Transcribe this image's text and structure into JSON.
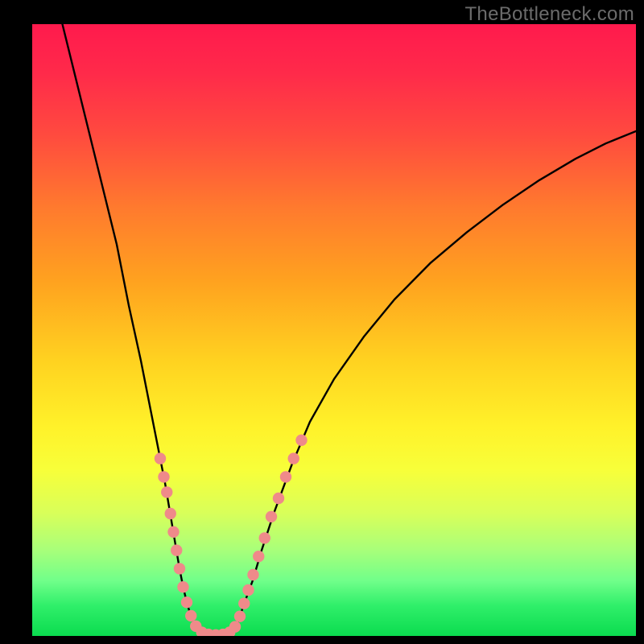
{
  "attribution": "TheBottleneck.com",
  "chart_data": {
    "type": "line",
    "title": "",
    "xlabel": "",
    "ylabel": "",
    "xlim": [
      0,
      100
    ],
    "ylim": [
      0,
      100
    ],
    "grid": false,
    "legend": false,
    "series": [
      {
        "name": "left-curve",
        "x": [
          5,
          8,
          11,
          14,
          16,
          18,
          19,
          20,
          21,
          22,
          22.6,
          23.2,
          23.8,
          24.4,
          25,
          25.6,
          26.2,
          26.8,
          27.4,
          28
        ],
        "y": [
          100,
          88,
          76,
          64,
          54,
          45,
          40,
          35,
          30,
          25,
          21.5,
          18,
          14.5,
          11,
          8,
          5.5,
          3.5,
          2,
          1,
          0.5
        ]
      },
      {
        "name": "valley-floor",
        "x": [
          28,
          29,
          30,
          31,
          32,
          33
        ],
        "y": [
          0.5,
          0.2,
          0.1,
          0.1,
          0.2,
          0.5
        ]
      },
      {
        "name": "right-curve",
        "x": [
          33,
          34,
          35,
          36.5,
          38,
          40,
          43,
          46,
          50,
          55,
          60,
          66,
          72,
          78,
          84,
          90,
          95,
          100
        ],
        "y": [
          0.5,
          2,
          5,
          9,
          14,
          20,
          28,
          35,
          42,
          49,
          55,
          61,
          66,
          70.5,
          74.5,
          78,
          80.5,
          82.5
        ]
      }
    ],
    "markers": {
      "name": "highlight-dots",
      "color": "#ef8a8a",
      "points": [
        {
          "x": 21.2,
          "y": 29
        },
        {
          "x": 21.8,
          "y": 26
        },
        {
          "x": 22.3,
          "y": 23.5
        },
        {
          "x": 22.9,
          "y": 20
        },
        {
          "x": 23.4,
          "y": 17
        },
        {
          "x": 23.9,
          "y": 14
        },
        {
          "x": 24.4,
          "y": 11
        },
        {
          "x": 25.0,
          "y": 8
        },
        {
          "x": 25.6,
          "y": 5.5
        },
        {
          "x": 26.3,
          "y": 3.3
        },
        {
          "x": 27.1,
          "y": 1.6
        },
        {
          "x": 28.1,
          "y": 0.6
        },
        {
          "x": 29.2,
          "y": 0.25
        },
        {
          "x": 30.4,
          "y": 0.15
        },
        {
          "x": 31.6,
          "y": 0.25
        },
        {
          "x": 32.7,
          "y": 0.6
        },
        {
          "x": 33.6,
          "y": 1.5
        },
        {
          "x": 34.4,
          "y": 3.2
        },
        {
          "x": 35.1,
          "y": 5.3
        },
        {
          "x": 35.8,
          "y": 7.5
        },
        {
          "x": 36.6,
          "y": 10
        },
        {
          "x": 37.5,
          "y": 13
        },
        {
          "x": 38.5,
          "y": 16
        },
        {
          "x": 39.6,
          "y": 19.5
        },
        {
          "x": 40.8,
          "y": 22.5
        },
        {
          "x": 42.0,
          "y": 26
        },
        {
          "x": 43.3,
          "y": 29
        },
        {
          "x": 44.6,
          "y": 32
        }
      ]
    }
  }
}
